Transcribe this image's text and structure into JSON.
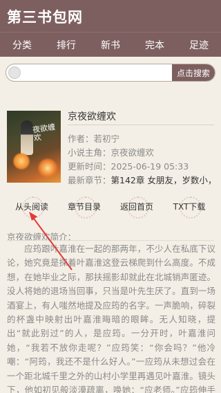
{
  "header": {
    "site_title": "第三书包网"
  },
  "nav": {
    "items": [
      "分类",
      "排行",
      "新书",
      "完本",
      "足迹"
    ]
  },
  "search": {
    "value": "",
    "button_label": "点击搜索"
  },
  "book": {
    "cover_title": "夜欲缠欢",
    "title": "京夜欲缠欢",
    "author_label": "作者：",
    "author": "若初宁",
    "protagonist_label": "小说主角：",
    "protagonist": "京夜欲缠欢",
    "updated_label": "更新时间：",
    "updated": "2025-06-19 05:33",
    "latest_label": "最新章节：",
    "latest": "第142章 女朋友，岁数小，"
  },
  "actions": [
    "从头阅读",
    "章节目录",
    "返回首页",
    "TXT下载"
  ],
  "description": {
    "title": "京夜欲缠欢简介：",
    "text": "应筠跟叶嘉淮在一起的那两年，不少人在私底下议论，她究竟是探着叶嘉淮这登云梯爬到什么高度。不成想，在她毕业之际，那扶摇影却就此在北城销声匿迹。没人将她的退场当回事，只当是叶先生厌了。直到一场酒宴上，有人嗤然地提及应筠的名字。一声脆响，碎裂的杯盏中映射出叶嘉淮晦暗的眼眸。无人知晓，提出“就此别过”的人，是应筠。一分开时，叶嘉淮问她，“我若不放你走呢？”应筠笑：“你会吗？”他冷嘲：“阿筠，我还不是什么好人。”一应筠从未想过会在一个距北城千里之外的山村小学里再遇见叶嘉淮。镜头下，他如初见般淡漠疏离，唤她：“应老师。”应筠伸手与他交握，眉目浅淡，“叶总好。”山野夜色深浓，老师们围聚在一块谈"
  },
  "colors": {
    "brand": "#7e5f5f",
    "background": "#f4efe6",
    "arrow": "#e53935"
  }
}
